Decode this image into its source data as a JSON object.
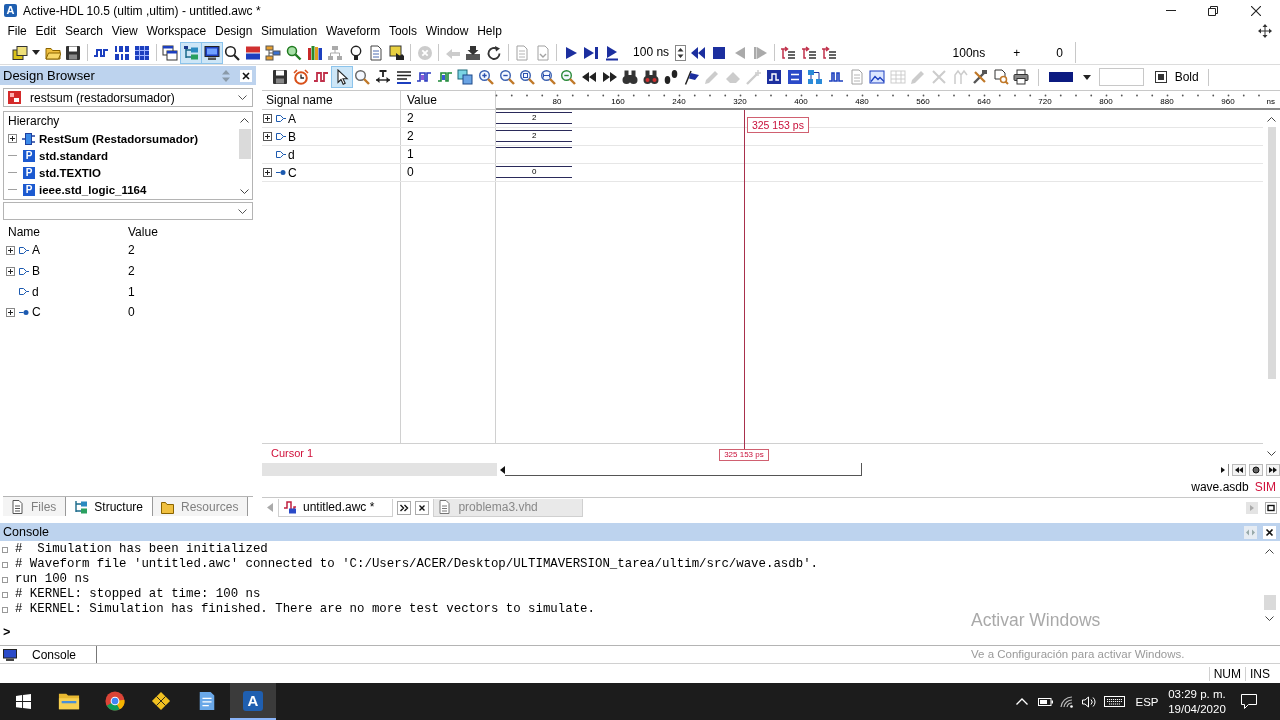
{
  "window": {
    "icon_text": "A",
    "title": "Active-HDL 10.5 (ultim ,ultim) - untitled.awc *"
  },
  "menu": [
    "File",
    "Edit",
    "Search",
    "View",
    "Workspace",
    "Design",
    "Simulation",
    "Waveform",
    "Tools",
    "Window",
    "Help"
  ],
  "main_toolbar": {
    "buttons": [
      {
        "on": false,
        "disabled": false
      },
      {
        "on": false,
        "disabled": false
      },
      {
        "on": false,
        "disabled": false
      },
      {
        "on": false,
        "disabled": false
      },
      {
        "on": false,
        "disabled": false
      },
      {
        "on": false,
        "disabled": false
      },
      {
        "on": false,
        "disabled": false
      },
      {
        "on": true,
        "disabled": false
      },
      {
        "on": true,
        "disabled": false
      },
      {
        "on": false,
        "disabled": false
      },
      {
        "on": false,
        "disabled": false
      },
      {
        "on": false,
        "disabled": false
      },
      {
        "on": false,
        "disabled": false
      },
      {
        "on": false,
        "disabled": false
      },
      {
        "on": false,
        "disabled": true
      },
      {
        "on": false,
        "disabled": false
      },
      {
        "on": false,
        "disabled": false
      },
      {
        "on": false,
        "disabled": false
      },
      {
        "on": false,
        "disabled": true
      },
      {
        "on": false,
        "disabled": true
      },
      {
        "on": false,
        "disabled": false
      },
      {
        "on": false,
        "disabled": false
      },
      {
        "on": false,
        "disabled": true
      },
      {
        "on": false,
        "disabled": true
      },
      {
        "on": false,
        "disabled": false
      },
      {
        "on": false,
        "disabled": false
      },
      {
        "on": false,
        "disabled": false
      },
      {
        "on": false,
        "disabled": false
      },
      {
        "on": false,
        "disabled": false
      },
      {
        "on": false,
        "disabled": true
      },
      {
        "on": false,
        "disabled": true
      },
      {
        "on": false,
        "disabled": false
      },
      {
        "on": false,
        "disabled": false
      },
      {
        "on": false,
        "disabled": false
      }
    ],
    "run_length": "100 ns",
    "sim_time": "100ns",
    "sim_delta_sign": "+",
    "sim_delta": "0"
  },
  "design_browser": {
    "title": "Design Browser",
    "design": "restsum (restadorsumador)",
    "hierarchy": {
      "title": "Hierarchy",
      "items": [
        {
          "kind": "unit",
          "label": "RestSum (Restadorsumador)"
        },
        {
          "kind": "package",
          "icon_text": "P",
          "label": "std.standard"
        },
        {
          "kind": "package",
          "icon_text": "P",
          "label": "std.TEXTIO"
        },
        {
          "kind": "package",
          "icon_text": "P",
          "label": "ieee.std_logic_1164"
        }
      ]
    },
    "columns": [
      "Name",
      "Value"
    ],
    "signals": [
      {
        "kind": "input",
        "expandable": true,
        "name": "A",
        "value": "2"
      },
      {
        "kind": "input",
        "expandable": true,
        "name": "B",
        "value": "2"
      },
      {
        "kind": "input",
        "expandable": false,
        "name": "d",
        "value": "1"
      },
      {
        "kind": "output",
        "expandable": true,
        "name": "C",
        "value": "0"
      }
    ],
    "tabs": [
      {
        "label": "Files",
        "selected": false
      },
      {
        "label": "Structure",
        "selected": true
      },
      {
        "label": "Resources",
        "selected": false
      }
    ]
  },
  "waveform": {
    "toolbar": {
      "buttons": [
        {
          "on": false,
          "disabled": false
        },
        {
          "on": false,
          "disabled": false
        },
        {
          "on": false,
          "disabled": false
        },
        {
          "on": true,
          "disabled": false
        },
        {
          "on": false,
          "disabled": false
        },
        {
          "on": false,
          "disabled": false
        },
        {
          "on": false,
          "disabled": false
        },
        {
          "on": false,
          "disabled": false
        },
        {
          "on": false,
          "disabled": false
        },
        {
          "on": false,
          "disabled": false
        },
        {
          "on": false,
          "disabled": false
        },
        {
          "on": false,
          "disabled": false
        },
        {
          "on": false,
          "disabled": false
        },
        {
          "on": false,
          "disabled": false
        },
        {
          "on": false,
          "disabled": false
        },
        {
          "on": false,
          "disabled": false
        },
        {
          "on": false,
          "disabled": false
        },
        {
          "on": false,
          "disabled": false
        },
        {
          "on": false,
          "disabled": false
        },
        {
          "on": false,
          "disabled": false
        },
        {
          "on": false,
          "disabled": false
        },
        {
          "on": false,
          "disabled": true
        },
        {
          "on": false,
          "disabled": true
        },
        {
          "on": false,
          "disabled": true
        },
        {
          "on": false,
          "disabled": false
        },
        {
          "on": false,
          "disabled": false
        },
        {
          "on": false,
          "disabled": false
        },
        {
          "on": false,
          "disabled": false
        },
        {
          "on": false,
          "disabled": true
        },
        {
          "on": false,
          "disabled": false
        },
        {
          "on": false,
          "disabled": true
        },
        {
          "on": false,
          "disabled": true
        },
        {
          "on": false,
          "disabled": true
        },
        {
          "on": false,
          "disabled": true
        },
        {
          "on": false,
          "disabled": false
        },
        {
          "on": false,
          "disabled": false
        },
        {
          "on": false,
          "disabled": false
        }
      ],
      "bold": {
        "label": "Bold",
        "checked": true
      }
    },
    "columns": [
      "Signal name",
      "Value"
    ],
    "ruler": {
      "ticks": [
        "80",
        "160",
        "240",
        "320",
        "400",
        "480",
        "560",
        "640",
        "720",
        "800",
        "880",
        "960"
      ],
      "unit": "ns"
    },
    "signals": [
      {
        "kind": "input",
        "expandable": true,
        "name": "A",
        "value": "2",
        "wave_label": "2"
      },
      {
        "kind": "input",
        "expandable": true,
        "name": "B",
        "value": "2",
        "wave_label": "2"
      },
      {
        "kind": "input",
        "expandable": false,
        "name": "d",
        "value": "1"
      },
      {
        "kind": "output",
        "expandable": true,
        "name": "C",
        "value": "0",
        "wave_label": "0"
      }
    ],
    "cursor": {
      "name": "Cursor 1",
      "time": "325 153 ps",
      "time_bottom": "325 153 ps"
    },
    "database": "wave.asdb",
    "mode": "SIM",
    "tabs": [
      {
        "label": "untitled.awc *",
        "selected": true
      },
      {
        "label": "problema3.vhd",
        "selected": false
      }
    ]
  },
  "console": {
    "title": "Console",
    "lines": [
      "#  Simulation has been initialized",
      "# Waveform file 'untitled.awc' connected to 'C:/Users/ACER/Desktop/ULTIMAVERSION_tarea/ultim/src/wave.asdb'.",
      "run 100 ns",
      "# KERNEL: stopped at time: 100 ns",
      "# KERNEL: Simulation has finished. There are no more test vectors to simulate."
    ],
    "prompt": ">",
    "tabs": [
      {
        "label": "Console",
        "selected": true
      }
    ]
  },
  "activation_notice": {
    "title": "Activar Windows",
    "text": "Ve a Configuración para activar Windows."
  },
  "status_bar": [
    "NUM",
    "INS"
  ],
  "taskbar": {
    "apps": [
      {
        "selected": false
      },
      {
        "selected": false
      },
      {
        "selected": false
      },
      {
        "selected": false
      },
      {
        "selected": true,
        "icon_text": "A"
      }
    ],
    "language": "ESP",
    "time": "03:29 p. m.",
    "date": "19/04/2020"
  }
}
